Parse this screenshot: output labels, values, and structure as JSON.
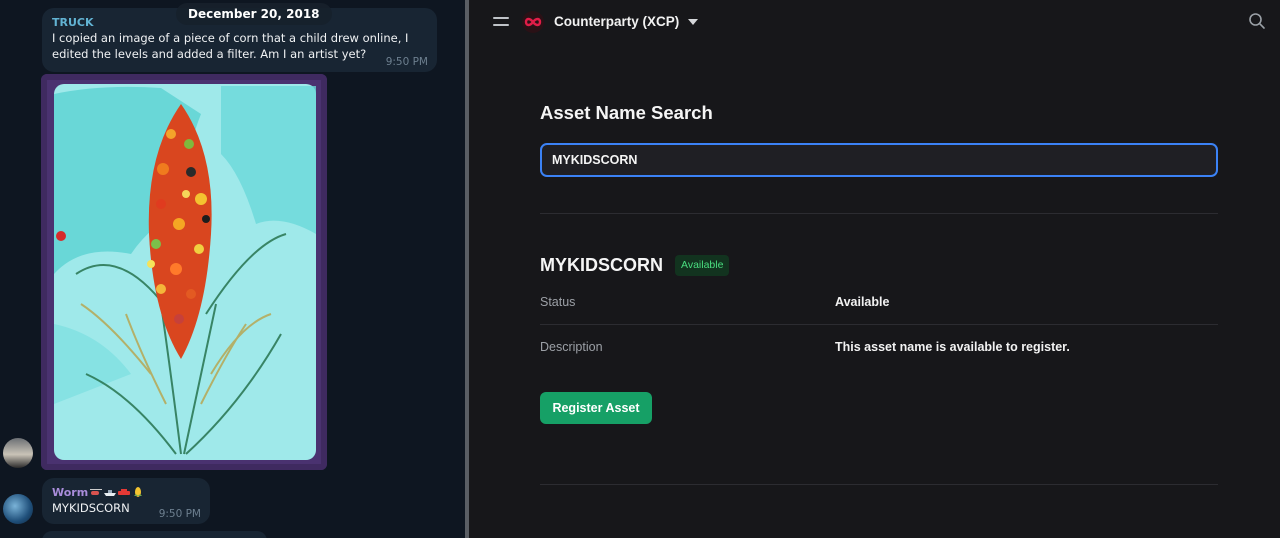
{
  "chat": {
    "date": "December 20, 2018",
    "messages": [
      {
        "sender": "TRUCK",
        "text": "I copied an image of a piece of corn that a child drew online, I edited the levels and added a filter. Am I an artist yet?",
        "time": "9:50 PM"
      },
      {
        "sender": "Worm",
        "emojis": [
          "helicopter-emoji",
          "ship-emoji",
          "car-emoji",
          "corn-emoji"
        ],
        "text": "MYKIDSCORN",
        "time": "9:50 PM"
      }
    ],
    "image_icon": "corn-drawing-image"
  },
  "app": {
    "title": "Counterparty (XCP)",
    "brand_color": "#e11d48",
    "menu_icon": "hamburger-icon",
    "search_icon": "search-icon"
  },
  "search": {
    "heading": "Asset Name Search",
    "value": "MYKIDSCORN"
  },
  "result": {
    "asset_name": "MYKIDSCORN",
    "badge": "Available",
    "rows": [
      {
        "label": "Status",
        "value": "Available"
      },
      {
        "label": "Description",
        "value": "This asset name is available to register."
      }
    ],
    "button_label": "Register Asset"
  },
  "colors": {
    "accent_blue": "#3b82f6",
    "success_green": "#16a066",
    "badge_green": "#4ade80"
  }
}
